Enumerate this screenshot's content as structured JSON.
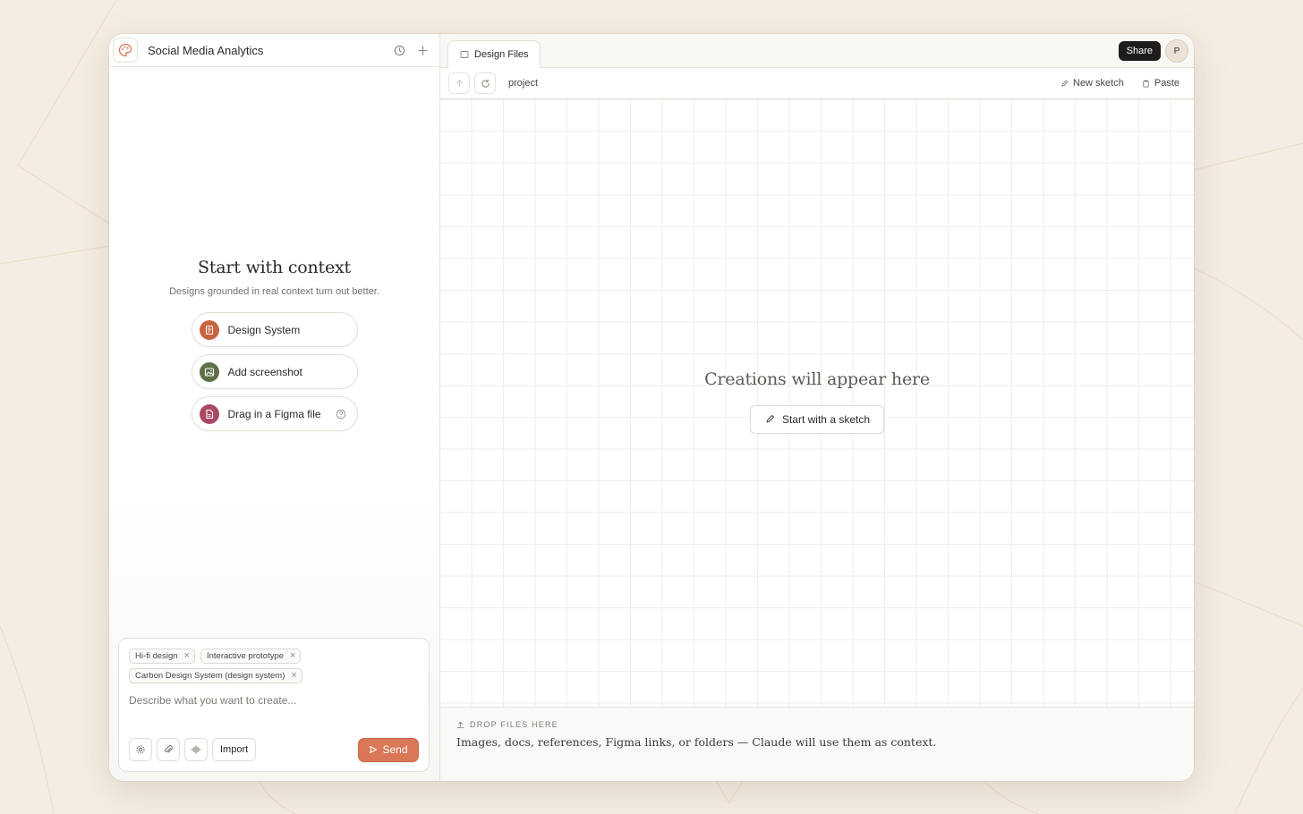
{
  "project": {
    "title": "Social Media Analytics"
  },
  "context": {
    "title": "Start with context",
    "subtitle": "Designs grounded in real context turn out better.",
    "options": [
      {
        "label": "Design System",
        "icon": "document-icon",
        "color": "#c8643f"
      },
      {
        "label": "Add screenshot",
        "icon": "image-icon",
        "color": "#5e7048"
      },
      {
        "label": "Drag in a Figma file",
        "icon": "file-icon",
        "color": "#a94a63"
      }
    ]
  },
  "composer": {
    "chips": [
      "Hi-fi design",
      "Interactive prototype",
      "Carbon Design System (design system)"
    ],
    "placeholder": "Describe what you want to create...",
    "import_label": "Import",
    "send_label": "Send"
  },
  "tabs": [
    {
      "label": "Design Files",
      "icon": "folder-icon"
    }
  ],
  "header": {
    "share_label": "Share",
    "avatar_initial": "P"
  },
  "toolbar": {
    "breadcrumb": "project",
    "new_sketch_label": "New sketch",
    "paste_label": "Paste"
  },
  "canvas": {
    "empty_title": "Creations will appear here",
    "sketch_button_label": "Start with a sketch"
  },
  "dropzone": {
    "label": "DROP FILES HERE",
    "text": "Images, docs, references, Figma links, or folders — Claude will use them as context."
  },
  "colors": {
    "accent": "#d97757",
    "background": "#f5ede3"
  }
}
